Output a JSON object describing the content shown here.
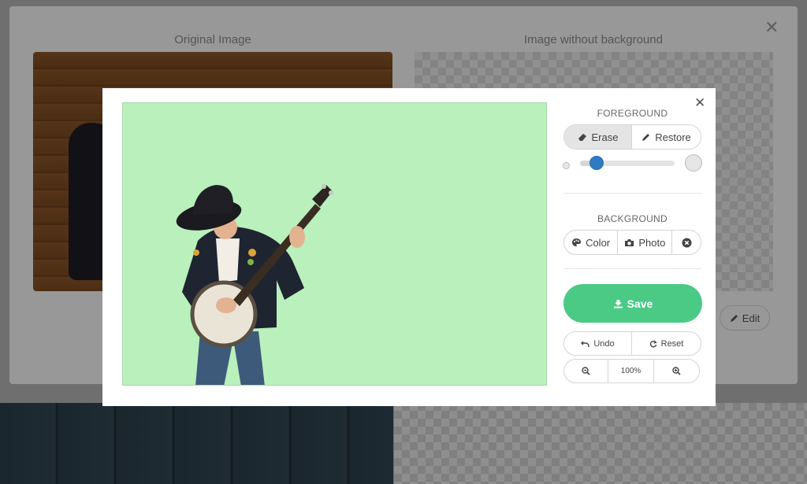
{
  "background_page": {
    "original_title": "Original Image",
    "result_title": "Image without background",
    "edit_label": "Edit"
  },
  "editor": {
    "foreground": {
      "heading": "FOREGROUND",
      "erase_label": "Erase",
      "restore_label": "Restore",
      "active_tool": "Erase",
      "brush_size_level": 0.18
    },
    "background": {
      "heading": "BACKGROUND",
      "color_label": "Color",
      "photo_label": "Photo"
    },
    "save_label": "Save",
    "undo_label": "Undo",
    "reset_label": "Reset",
    "zoom_label": "100%",
    "canvas_color": "#b9f0bc",
    "save_color": "#4bca85",
    "accent_color": "#2f7bc3"
  }
}
